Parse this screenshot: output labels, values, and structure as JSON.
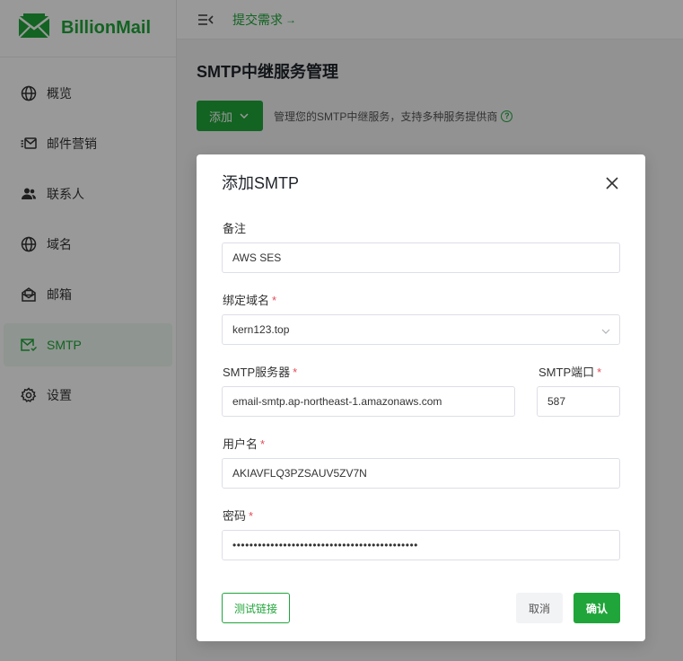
{
  "brand": {
    "name": "BillionMail"
  },
  "sidebar": {
    "items": [
      {
        "label": "概览",
        "icon": "globe-icon"
      },
      {
        "label": "邮件营销",
        "icon": "mail-list-icon"
      },
      {
        "label": "联系人",
        "icon": "contacts-icon"
      },
      {
        "label": "域名",
        "icon": "globe-icon"
      },
      {
        "label": "邮箱",
        "icon": "mailbox-icon"
      },
      {
        "label": "SMTP",
        "icon": "smtp-icon",
        "active": true
      },
      {
        "label": "设置",
        "icon": "gear-icon"
      }
    ]
  },
  "header": {
    "link_label": "提交需求",
    "link_arrow": "→"
  },
  "page": {
    "title": "SMTP中继服务管理",
    "add_button": "添加",
    "tip": "管理您的SMTP中继服务，支持多种服务提供商",
    "help": "?"
  },
  "modal": {
    "title": "添加SMTP",
    "fields": {
      "remark": {
        "label": "备注",
        "value": "AWS SES"
      },
      "domain": {
        "label": "绑定域名",
        "value": "kern123.top"
      },
      "server": {
        "label": "SMTP服务器",
        "value": "email-smtp.ap-northeast-1.amazonaws.com"
      },
      "port": {
        "label": "SMTP端口",
        "value": "587"
      },
      "username": {
        "label": "用户名",
        "value": "AKIAVFLQ3PZSAUV5ZV7N"
      },
      "password": {
        "label": "密码",
        "value": "••••••••••••••••••••••••••••••••••••••••••••"
      }
    },
    "required_mark": "*",
    "buttons": {
      "test": "测试链接",
      "cancel": "取消",
      "confirm": "确认"
    }
  },
  "colors": {
    "accent": "#20a53a",
    "required": "#e34d59",
    "overlay": "rgba(0,0,0,0.40)"
  }
}
